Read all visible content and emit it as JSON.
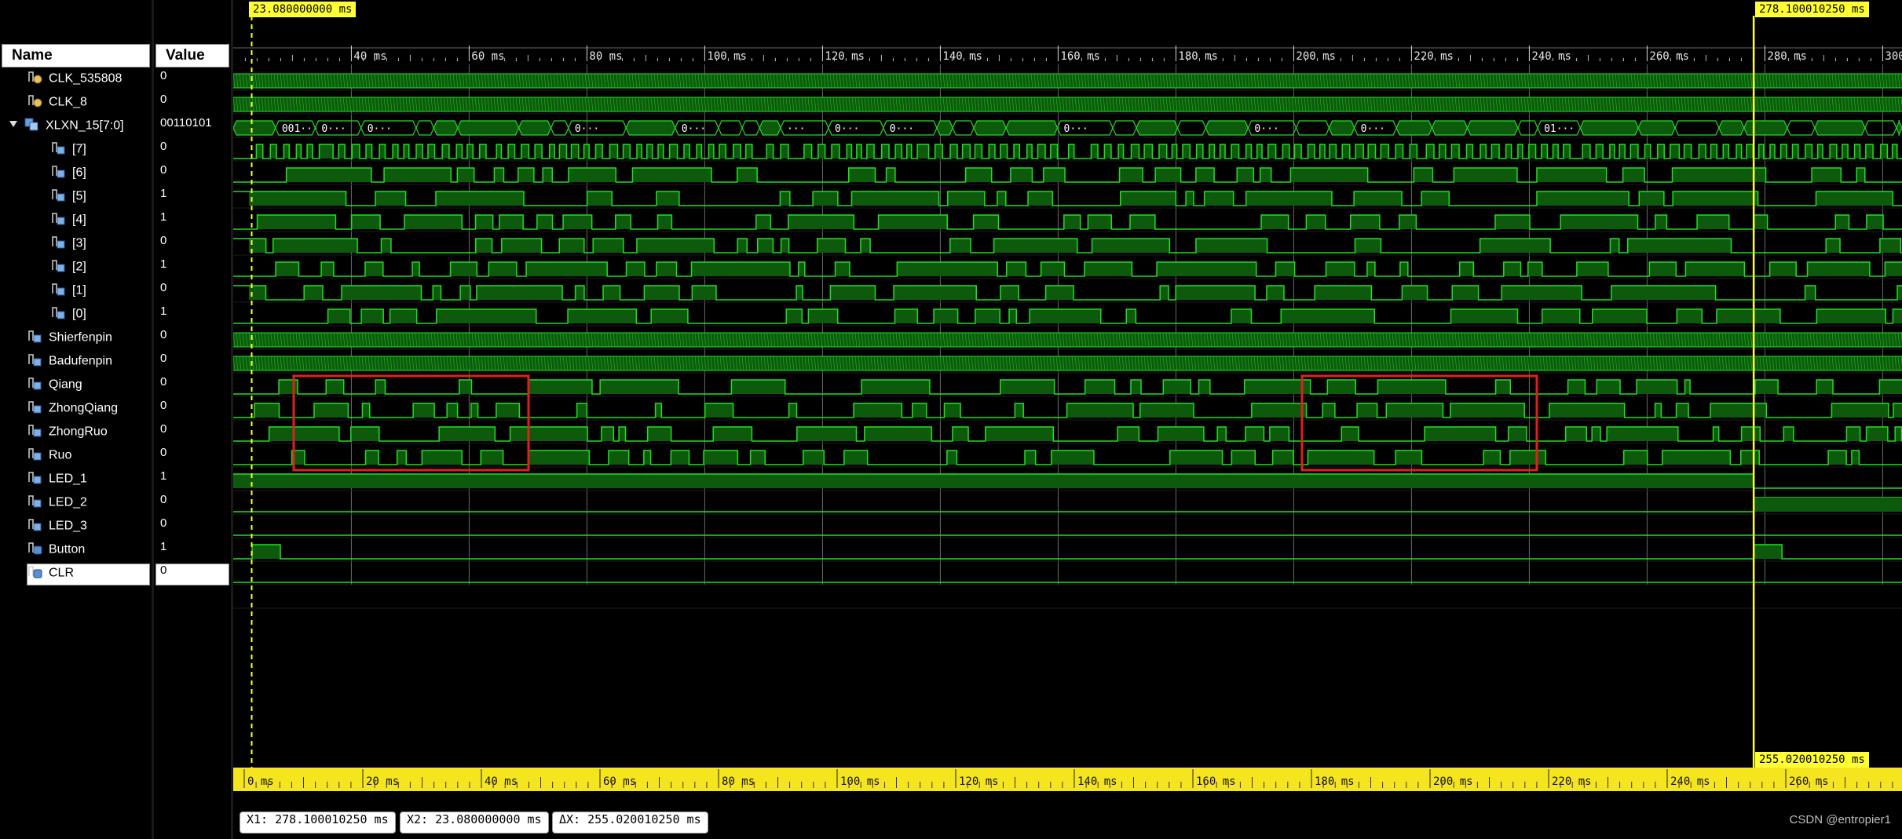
{
  "columns": {
    "name_header": "Name",
    "value_header": "Value"
  },
  "signals": [
    {
      "name": "CLK_535808",
      "value": "0",
      "icon": "clock-signal-icon",
      "expander": false,
      "indent": 0
    },
    {
      "name": "CLK_8",
      "value": "0",
      "icon": "clock-signal-icon",
      "expander": false,
      "indent": 0
    },
    {
      "name": "XLXN_15[7:0]",
      "value": "00110101",
      "icon": "bus-signal-icon",
      "expander": true,
      "indent": 0
    },
    {
      "name": "[7]",
      "value": "0",
      "icon": "bit-signal-icon",
      "expander": false,
      "indent": 1
    },
    {
      "name": "[6]",
      "value": "0",
      "icon": "bit-signal-icon",
      "expander": false,
      "indent": 1
    },
    {
      "name": "[5]",
      "value": "1",
      "icon": "bit-signal-icon",
      "expander": false,
      "indent": 1
    },
    {
      "name": "[4]",
      "value": "1",
      "icon": "bit-signal-icon",
      "expander": false,
      "indent": 1
    },
    {
      "name": "[3]",
      "value": "0",
      "icon": "bit-signal-icon",
      "expander": false,
      "indent": 1
    },
    {
      "name": "[2]",
      "value": "1",
      "icon": "bit-signal-icon",
      "expander": false,
      "indent": 1
    },
    {
      "name": "[1]",
      "value": "0",
      "icon": "bit-signal-icon",
      "expander": false,
      "indent": 1
    },
    {
      "name": "[0]",
      "value": "1",
      "icon": "bit-signal-icon",
      "expander": false,
      "indent": 1
    },
    {
      "name": "Shierfenpin",
      "value": "0",
      "icon": "bit-signal-icon",
      "expander": false,
      "indent": 0
    },
    {
      "name": "Badufenpin",
      "value": "0",
      "icon": "bit-signal-icon",
      "expander": false,
      "indent": 0
    },
    {
      "name": "Qiang",
      "value": "0",
      "icon": "bit-signal-icon",
      "expander": false,
      "indent": 0
    },
    {
      "name": "ZhongQiang",
      "value": "0",
      "icon": "bit-signal-icon",
      "expander": false,
      "indent": 0
    },
    {
      "name": "ZhongRuo",
      "value": "0",
      "icon": "bit-signal-icon",
      "expander": false,
      "indent": 0
    },
    {
      "name": "Ruo",
      "value": "0",
      "icon": "bit-signal-icon",
      "expander": false,
      "indent": 0
    },
    {
      "name": "LED_1",
      "value": "1",
      "icon": "bit-signal-icon",
      "expander": false,
      "indent": 0
    },
    {
      "name": "LED_2",
      "value": "0",
      "icon": "bit-signal-icon",
      "expander": false,
      "indent": 0
    },
    {
      "name": "LED_3",
      "value": "0",
      "icon": "bit-signal-icon",
      "expander": false,
      "indent": 0
    },
    {
      "name": "Button",
      "value": "1",
      "icon": "input-signal-icon",
      "expander": false,
      "indent": 0
    },
    {
      "name": "CLR",
      "value": "0",
      "icon": "input-signal-icon",
      "expander": false,
      "indent": 0,
      "selected": true
    }
  ],
  "top_ruler": {
    "unit": "ms",
    "ticks": [
      "40 ms",
      "60 ms",
      "80 ms",
      "100 ms",
      "120 ms",
      "140 ms",
      "160 ms",
      "180 ms",
      "200 ms",
      "220 ms",
      "240 ms",
      "260 ms",
      "280 ms",
      "300 ms"
    ]
  },
  "bottom_ruler": {
    "ticks": [
      "0 ms",
      "20 ms",
      "40 ms",
      "60 ms",
      "80 ms",
      "100 ms",
      "120 ms",
      "140 ms",
      "160 ms",
      "180 ms",
      "200 ms",
      "220 ms",
      "240 ms",
      "260 ms"
    ]
  },
  "cursors": {
    "x2_label": "23.080000000 ms",
    "x1_label": "278.100010250 ms",
    "delta_label": "255.020010250 ms"
  },
  "bus_labels": [
    "001···",
    "0···",
    "0···",
    "0···",
    "0···",
    "···",
    "0···",
    "0···",
    "0···",
    "0···",
    "0···",
    "01···"
  ],
  "measurements": {
    "x1": "X1: 278.100010250 ms",
    "x2": "X2: 23.080000000 ms",
    "dx": "ΔX: 255.020010250 ms"
  },
  "watermark": "CSDN @entropier1",
  "colors": {
    "wave": "#22dd22",
    "wave_fill": "#0d5a0d",
    "cursor": "#ffff33",
    "grid": "#9a9a9a",
    "highlight_box": "#e02020",
    "ruler_bg": "#f5e51e"
  }
}
